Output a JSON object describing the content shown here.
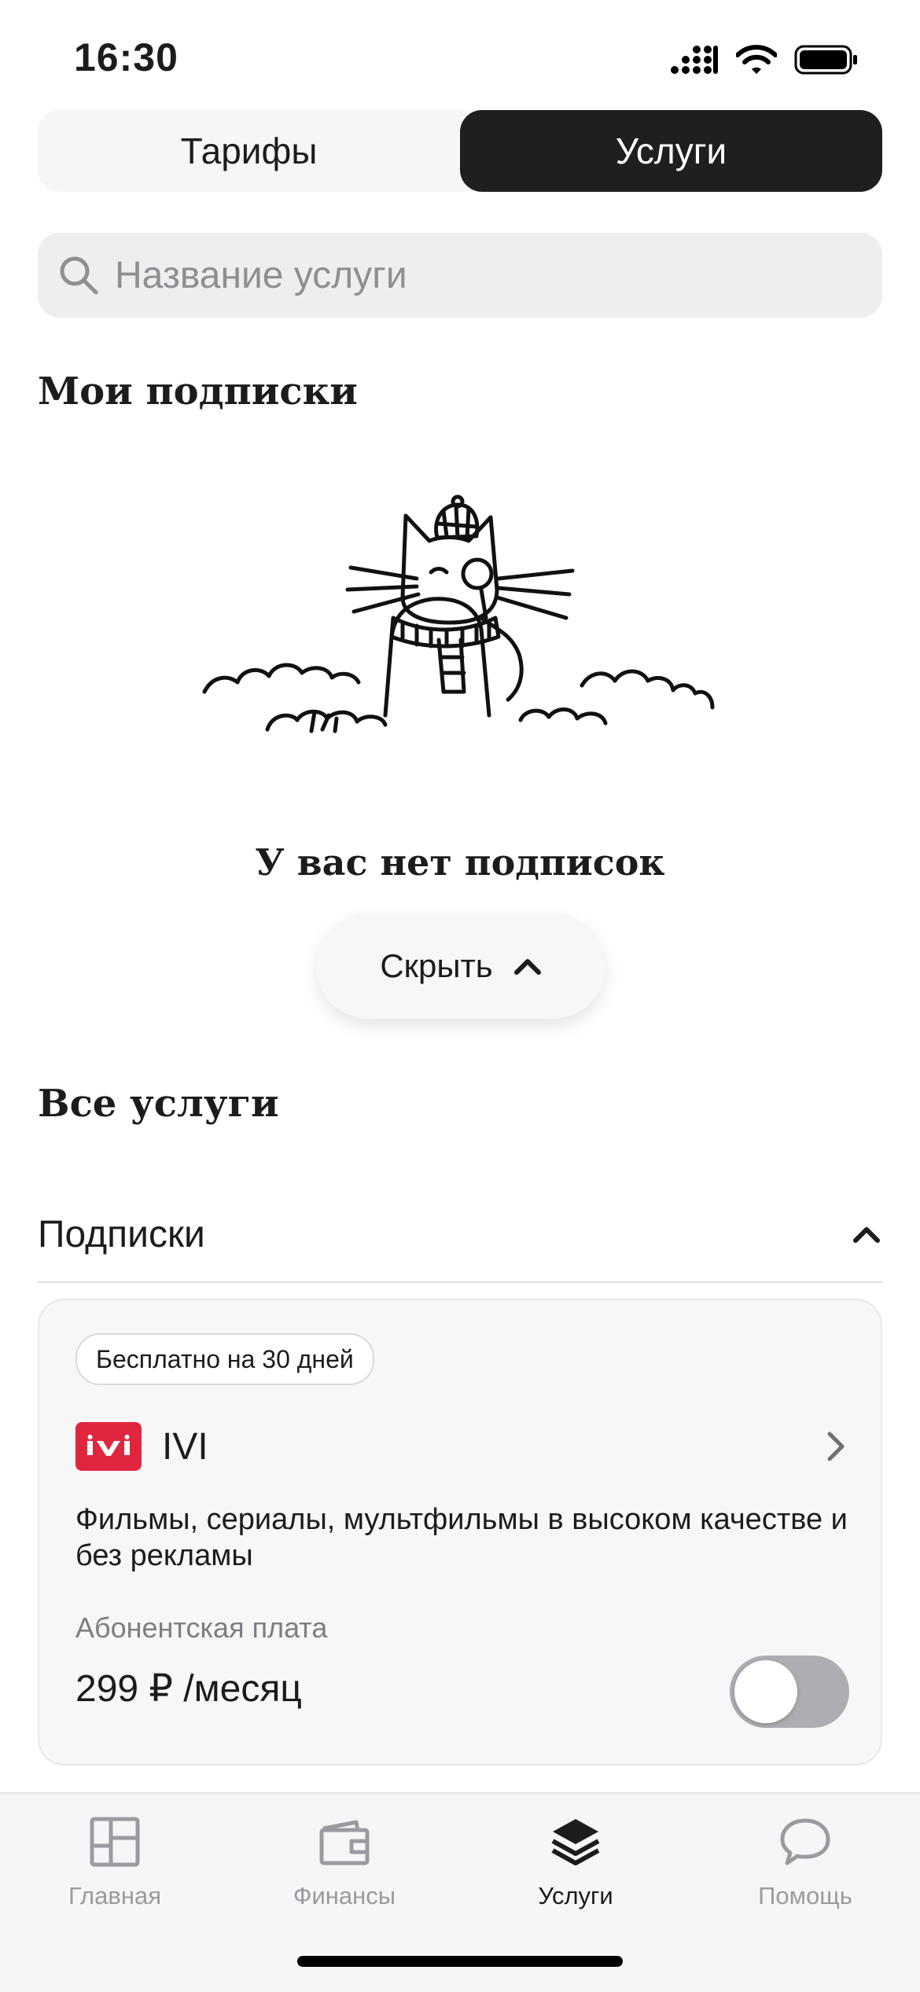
{
  "status_bar": {
    "time": "16:30"
  },
  "tabs_segment": {
    "tariffs": "Тарифы",
    "services": "Услуги",
    "active": "services"
  },
  "search": {
    "placeholder": "Название услуги",
    "value": ""
  },
  "my_subscriptions": {
    "title": "Мои подписки",
    "empty_text": "У вас нет подписок",
    "hide_label": "Скрыть",
    "illustration": "cat-detective-illustration"
  },
  "all_services": {
    "title": "Все услуги",
    "category": {
      "label": "Подписки",
      "expanded": true
    },
    "card": {
      "badge": "Бесплатно на 30 дней",
      "logo": "ivi",
      "name": "IVI",
      "description": "Фильмы, сериалы, мультфильмы в высоком качестве и без рекламы",
      "fee_label": "Абонентская плата",
      "price": "299 ₽ /месяц",
      "enabled": false
    }
  },
  "tab_bar": {
    "items": [
      {
        "label": "Главная",
        "icon": "dashboard-icon",
        "active": false
      },
      {
        "label": "Финансы",
        "icon": "wallet-icon",
        "active": false
      },
      {
        "label": "Услуги",
        "icon": "layers-icon",
        "active": true
      },
      {
        "label": "Помощь",
        "icon": "chat-bubble-icon",
        "active": false
      }
    ]
  },
  "colors": {
    "segment_active_bg": "#1f1f22",
    "ivi_brand": "#e0263f",
    "toggle_off": "#adadb3"
  }
}
